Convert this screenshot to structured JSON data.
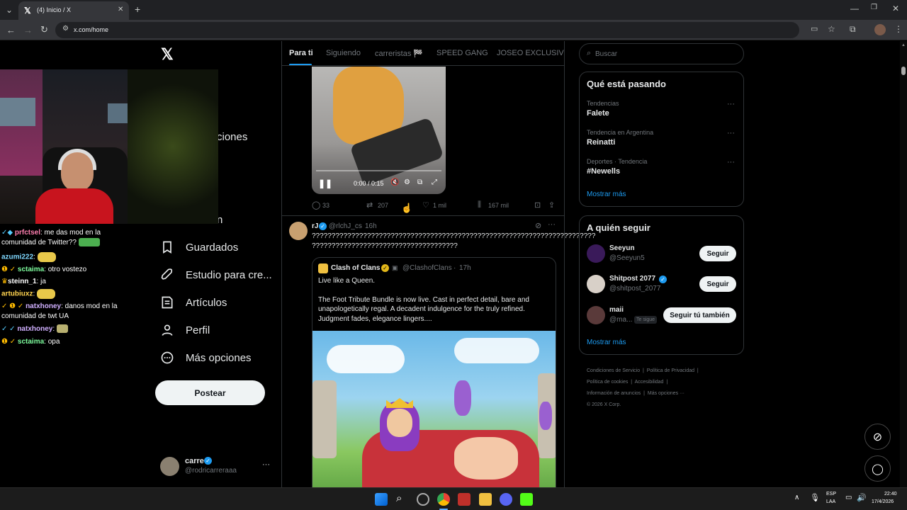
{
  "browser": {
    "tab_title": "(4) Inicio / X",
    "url": "x.com/home"
  },
  "nav": {
    "more_options_partial": "ciones",
    "partial_item": "n",
    "items": [
      {
        "label": "Guardados",
        "icon": "bookmark-icon"
      },
      {
        "label": "Estudio para cre...",
        "icon": "rocket-icon"
      },
      {
        "label": "Artículos",
        "icon": "article-icon"
      },
      {
        "label": "Perfil",
        "icon": "person-icon"
      },
      {
        "label": "Más opciones",
        "icon": "more-circle-icon"
      }
    ],
    "post_button": "Postear",
    "account": {
      "name": "carre",
      "handle": "@rodricarreraaa"
    }
  },
  "stream_chat": [
    {
      "user": "prfctsel",
      "text": ": me das mod en la",
      "cont": "comunidad de Twitter??",
      "user_color": "#ff7fb0"
    },
    {
      "user": "azumi222",
      "text": ":",
      "user_color": "#7fd8ff"
    },
    {
      "user": "sctaima",
      "text": ": otro vostezo",
      "user_color": "#7fff9f"
    },
    {
      "user": "steinn_1",
      "text": ": ja",
      "user_color": "#ffffff"
    },
    {
      "user": "artubiuxz",
      "text": ":",
      "user_color": "#ffd34f"
    },
    {
      "user": "natxhoney",
      "text": ": danos mod en la",
      "cont": "comunidad de twt UA",
      "user_color": "#d0b0ff"
    },
    {
      "user": "natxhoney",
      "text": ":",
      "user_color": "#d0b0ff"
    },
    {
      "user": "sctaima",
      "text": ": opa",
      "user_color": "#7fff9f"
    }
  ],
  "timeline": {
    "tabs": [
      "Para ti",
      "Siguiendo",
      "carreristas 🏁",
      "SPEED GANG",
      "JOSEO EXCLUSIVE C"
    ],
    "video": {
      "time": "0:00 / 0:15"
    },
    "actions1": {
      "replies": "33",
      "reposts": "207",
      "likes": "1 mil",
      "views": "167 mil"
    },
    "post2": {
      "name": "rJ",
      "handle": "@rlchJ_cs",
      "time": "16h",
      "text_line1": "????????????????????????????????????????????????????????????????????????",
      "text_line2": "?????????????????????????????????????",
      "quote": {
        "name": "Clash of Clans",
        "handle": "@ClashofClans",
        "time": "17h",
        "line1": "Live like a Queen.",
        "line2": "The Foot Tribute Bundle is now live. Cast in perfect detail, bare and",
        "line3": "unapologetically regal. A decadent indulgence for the truly refined.",
        "line4": "Judgment fades, elegance lingers...."
      }
    }
  },
  "sidebar": {
    "search_placeholder": "Buscar",
    "trends_title": "Qué está pasando",
    "trends": [
      {
        "meta": "Tendencias",
        "name": "Falete"
      },
      {
        "meta": "Tendencia en Argentina",
        "name": "Reinatti"
      },
      {
        "meta": "Deportes · Tendencia",
        "name": "#Newells"
      }
    ],
    "show_more": "Mostrar más",
    "who_title": "A quién seguir",
    "who": [
      {
        "name": "Seeyun",
        "handle": "@Seeyun5",
        "button": "Seguir"
      },
      {
        "name": "Shitpost 2077",
        "handle": "@shitpost_2077",
        "button": "Seguir"
      },
      {
        "name": "maii",
        "handle": "@ma...",
        "badge": "Te sigue",
        "button": "Seguir tú también"
      }
    ],
    "show_more2": "Mostrar más",
    "footer": {
      "l1a": "Condiciones de Servicio",
      "l1b": "Política de Privacidad",
      "l2a": "Política de cookies",
      "l2b": "Accesibilidad",
      "l3a": "Información de anuncios",
      "l3b": "Más opciones ···",
      "copy": "© 2026 X Corp."
    }
  },
  "taskbar": {
    "lang1": "ESP",
    "lang2": "LAA",
    "time": "22:40",
    "date": "17/4/2026"
  },
  "colors": {
    "accent": "#1d9bf0",
    "border": "#2f3336",
    "muted": "#71767b"
  }
}
